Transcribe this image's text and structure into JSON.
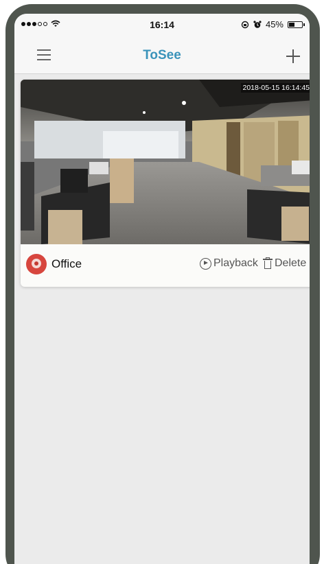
{
  "status_bar": {
    "time": "16:14",
    "battery_text": "45%",
    "battery_level": 0.45
  },
  "nav": {
    "title": "ToSee",
    "left_icon": "menu-icon",
    "right_icon": "add-icon"
  },
  "device": {
    "name": "Office",
    "timestamp": "2018-05-15 16:14:45",
    "playback_label": "Playback",
    "delete_label": "Delete"
  },
  "colors": {
    "title_accent": "#3a93ba",
    "device_icon": "#d7463e",
    "background": "#ebebeb"
  }
}
